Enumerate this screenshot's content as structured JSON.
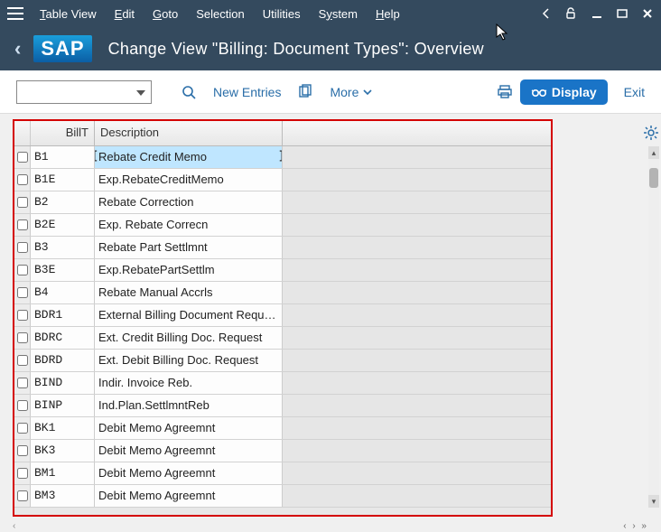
{
  "menubar": {
    "items": [
      "Table View",
      "Edit",
      "Goto",
      "Selection",
      "Utilities",
      "System",
      "Help"
    ]
  },
  "titlebar": {
    "logo": "SAP",
    "title": "Change View \"Billing: Document Types\": Overview"
  },
  "toolbar": {
    "combo_value": "",
    "new_entries": "New Entries",
    "more": "More",
    "display": "Display",
    "exit": "Exit"
  },
  "grid": {
    "columns": {
      "billt": "BillT",
      "description": "Description"
    },
    "rows": [
      {
        "billt": "B1",
        "description": "Rebate Credit Memo",
        "selected": true
      },
      {
        "billt": "B1E",
        "description": "Exp.RebateCreditMemo"
      },
      {
        "billt": "B2",
        "description": "Rebate Correction"
      },
      {
        "billt": "B2E",
        "description": "Exp. Rebate Correcn"
      },
      {
        "billt": "B3",
        "description": "Rebate Part Settlmnt"
      },
      {
        "billt": "B3E",
        "description": "Exp.RebatePartSettlm"
      },
      {
        "billt": "B4",
        "description": "Rebate Manual Accrls"
      },
      {
        "billt": "BDR1",
        "description": "External Billing Document Requ…"
      },
      {
        "billt": "BDRC",
        "description": "Ext. Credit Billing Doc. Request"
      },
      {
        "billt": "BDRD",
        "description": "Ext. Debit Billing Doc. Request"
      },
      {
        "billt": "BIND",
        "description": "Indir. Invoice Reb."
      },
      {
        "billt": "BINP",
        "description": "Ind.Plan.SettlmntReb"
      },
      {
        "billt": "BK1",
        "description": "Debit Memo Agreemnt"
      },
      {
        "billt": "BK3",
        "description": "Debit Memo Agreemnt"
      },
      {
        "billt": "BM1",
        "description": "Debit Memo Agreemnt"
      },
      {
        "billt": "BM3",
        "description": "Debit Memo Agreemnt"
      }
    ]
  }
}
